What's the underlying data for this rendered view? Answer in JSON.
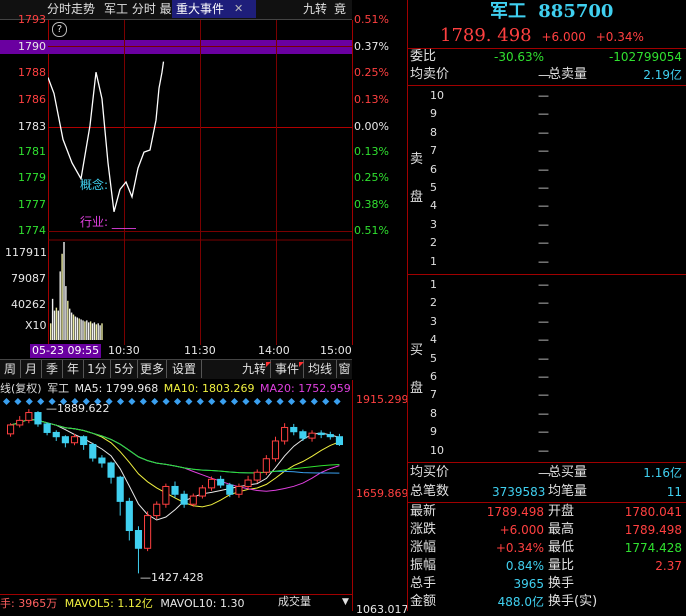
{
  "top_tabs": {
    "intraday": "分时走势",
    "name_tab": "军工 分时 最",
    "events": "重大事件",
    "close": "✕",
    "nine_turn": "九转",
    "auction": "竟"
  },
  "intraday": {
    "help": "?",
    "price_ticks": [
      "1793",
      "1790",
      "1788",
      "1786",
      "1783",
      "1781",
      "1779",
      "1777",
      "1774"
    ],
    "pct_ticks": [
      "0.51%",
      "0.37%",
      "0.25%",
      "0.13%",
      "0.00%",
      "0.13%",
      "0.25%",
      "0.38%",
      "0.51%"
    ],
    "concept_label": "概念:",
    "industry_label": "行业: ____",
    "vol_ticks": [
      "117911",
      "79087",
      "40262"
    ],
    "vol_unit": "X10",
    "time_labels": [
      "05-23 09:55",
      "10:30",
      "11:30",
      "14:00",
      "15:00"
    ],
    "price_line": [
      [
        0.0,
        1788.0
      ],
      [
        0.02,
        1786.5
      ],
      [
        0.05,
        1782.2
      ],
      [
        0.08,
        1780.0
      ],
      [
        0.11,
        1778.5
      ],
      [
        0.14,
        1783.5
      ],
      [
        0.16,
        1788.5
      ],
      [
        0.18,
        1786.0
      ],
      [
        0.2,
        1780.0
      ],
      [
        0.22,
        1775.4
      ],
      [
        0.24,
        1777.5
      ],
      [
        0.26,
        1778.2
      ],
      [
        0.28,
        1776.8
      ],
      [
        0.3,
        1779.5
      ],
      [
        0.32,
        1781.0
      ],
      [
        0.34,
        1781.2
      ],
      [
        0.36,
        1784.0
      ],
      [
        0.37,
        1787.0
      ],
      [
        0.38,
        1788.5
      ],
      [
        0.385,
        1789.498
      ]
    ],
    "volume_bars": [
      0.17,
      0.42,
      0.3,
      0.33,
      0.3,
      0.7,
      0.88,
      1.0,
      0.55,
      0.4,
      0.32,
      0.28,
      0.26,
      0.24,
      0.23,
      0.22,
      0.21,
      0.2,
      0.19,
      0.2,
      0.18,
      0.19,
      0.17,
      0.18,
      0.16,
      0.17,
      0.15,
      0.17
    ]
  },
  "kline_tabs": [
    "周",
    "月",
    "季",
    "年",
    "1分",
    "5分",
    "更多",
    "设置",
    "九转",
    "事件",
    "均线",
    "窗"
  ],
  "kline": {
    "ma_bar": {
      "prefix": "线(复权)",
      "name": "军工",
      "ma5": "MA5: 1799.968",
      "ma10": "MA10: 1803.269",
      "ma20": "MA20: 1752.959"
    },
    "price_ticks": [
      "1915.299",
      "1659.869",
      "1063.017"
    ],
    "high_label": "1889.622",
    "low_label": "1427.428",
    "candles": [
      [
        1820,
        1845,
        1850,
        1812
      ],
      [
        1845,
        1858,
        1870,
        1838
      ],
      [
        1858,
        1880,
        1889.6,
        1850
      ],
      [
        1880,
        1848,
        1884,
        1840
      ],
      [
        1848,
        1824,
        1852,
        1816
      ],
      [
        1824,
        1812,
        1830,
        1800
      ],
      [
        1812,
        1795,
        1816,
        1782
      ],
      [
        1795,
        1812,
        1820,
        1788
      ],
      [
        1812,
        1790,
        1816,
        1775
      ],
      [
        1790,
        1752,
        1795,
        1742
      ],
      [
        1752,
        1738,
        1760,
        1725
      ],
      [
        1738,
        1698,
        1742,
        1680
      ],
      [
        1698,
        1630,
        1702,
        1590
      ],
      [
        1630,
        1548,
        1640,
        1520
      ],
      [
        1548,
        1498,
        1560,
        1427.4
      ],
      [
        1498,
        1590,
        1602,
        1490
      ],
      [
        1590,
        1622,
        1630,
        1580
      ],
      [
        1622,
        1672,
        1680,
        1612
      ],
      [
        1672,
        1650,
        1686,
        1640
      ],
      [
        1650,
        1622,
        1660,
        1612
      ],
      [
        1622,
        1645,
        1652,
        1615
      ],
      [
        1645,
        1668,
        1676,
        1638
      ],
      [
        1668,
        1692,
        1700,
        1660
      ],
      [
        1692,
        1676,
        1702,
        1668
      ],
      [
        1676,
        1650,
        1682,
        1642
      ],
      [
        1650,
        1672,
        1680,
        1640
      ],
      [
        1672,
        1690,
        1702,
        1664
      ],
      [
        1690,
        1712,
        1720,
        1682
      ],
      [
        1712,
        1750,
        1760,
        1704
      ],
      [
        1750,
        1800,
        1812,
        1742
      ],
      [
        1800,
        1838,
        1850,
        1790
      ],
      [
        1838,
        1826,
        1848,
        1816
      ],
      [
        1826,
        1808,
        1832,
        1800
      ],
      [
        1808,
        1822,
        1830,
        1798
      ],
      [
        1822,
        1818,
        1830,
        1808
      ],
      [
        1818,
        1812,
        1826,
        1804
      ],
      [
        1812,
        1790,
        1820,
        1786
      ]
    ],
    "volume_label": "手: 3965万",
    "mavol5": "MAVOL5: 1.12亿",
    "mavol10": "MAVOL10: 1.30",
    "vol_select": "成交量"
  },
  "quote": {
    "name": "军工",
    "code": "885700",
    "price": "1789. 498",
    "change": "+6.000",
    "change_pct": "+0.34%",
    "weibi_label": "委比",
    "weibi_value": "-30.63%",
    "weicha_value": "-102799054",
    "avg_sell_label": "均卖价",
    "total_sell_label": "总卖量",
    "total_sell_value": "2.19亿",
    "sell_side_label": [
      "卖",
      "盘"
    ],
    "sell_levels": [
      "10",
      "9",
      "8",
      "7",
      "6",
      "5",
      "4",
      "3",
      "2",
      "1"
    ],
    "buy_side_label": [
      "买",
      "盘"
    ],
    "buy_levels": [
      "1",
      "2",
      "3",
      "4",
      "5",
      "6",
      "7",
      "8",
      "9",
      "10"
    ],
    "dash": "—",
    "avg_buy_label": "均买价",
    "total_buy_label": "总买量",
    "total_buy_value": "1.16亿",
    "total_trades_label": "总笔数",
    "total_trades_value": "3739583",
    "avg_per_trade_label": "均笔量",
    "avg_per_trade_value": "11",
    "rows": [
      {
        "l1": "最新",
        "v1": "1789.498",
        "l2": "开盘",
        "v2": "1780.041"
      },
      {
        "l1": "涨跌",
        "v1": "+6.000",
        "l2": "最高",
        "v2": "1789.498"
      },
      {
        "l1": "涨幅",
        "v1": "+0.34%",
        "l2": "最低",
        "v2": "1774.428"
      },
      {
        "l1": "振幅",
        "v1": "0.84%",
        "l2": "量比",
        "v2": "2.37"
      },
      {
        "l1": "总手",
        "v1": "3965",
        "l2": "换手",
        "v2": ""
      },
      {
        "l1": "金额",
        "v1": "488.0亿",
        "l2": "换手(实)",
        "v2": ""
      }
    ]
  },
  "colors": {
    "up": "#ff4040",
    "down": "#30e030",
    "grid": "#7a0000",
    "accent_bar": "#6a00a0",
    "ma5": "#e8e8e8",
    "ma10": "#f0f040",
    "ma20": "#e040e0"
  }
}
